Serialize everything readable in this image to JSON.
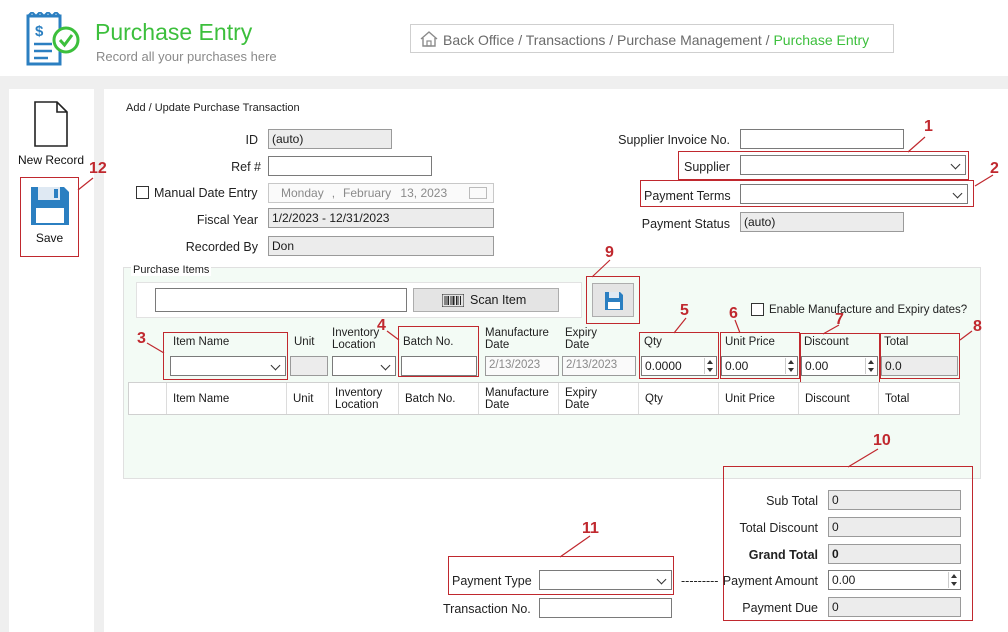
{
  "header": {
    "title": "Purchase Entry",
    "subtitle": "Record all your purchases here",
    "breadcrumb": {
      "part1": "Back Office / Transactions / Purchase Management / ",
      "active": "Purchase Entry"
    }
  },
  "toolbar": {
    "new_label": "New Record",
    "save_label": "Save"
  },
  "form": {
    "group_title": "Add / Update Purchase Transaction",
    "id_label": "ID",
    "id_value": "(auto)",
    "ref_label": "Ref #",
    "ref_value": "",
    "manual_date_label": "Manual Date Entry",
    "date_day": "Monday",
    "date_sep": ",",
    "date_month": "February",
    "date_rest": "13, 2023",
    "fiscal_label": "Fiscal Year",
    "fiscal_value": "1/2/2023 - 12/31/2023",
    "recorded_label": "Recorded By",
    "recorded_value": "Don",
    "supplier_invoice_label": "Supplier Invoice No.",
    "supplier_invoice_value": "",
    "supplier_label": "Supplier",
    "supplier_value": "",
    "payment_terms_label": "Payment Terms",
    "payment_terms_value": "",
    "payment_status_label": "Payment Status",
    "payment_status_value": "(auto)"
  },
  "items": {
    "group_title": "Purchase Items",
    "scan_input": "",
    "scan_label": "Scan Item",
    "enable_label": "Enable Manufacture and Expiry dates?",
    "col_item": "Item Name",
    "col_unit": "Unit",
    "col_loc1": "Inventory",
    "col_loc2": "Location",
    "col_batch": "Batch No.",
    "col_mfg1": "Manufacture",
    "col_mfg2": "Date",
    "col_exp1": "Expiry",
    "col_exp2": "Date",
    "col_qty": "Qty",
    "col_price": "Unit Price",
    "col_disc": "Discount",
    "col_total": "Total",
    "mfg_value": "2/13/2023",
    "exp_value": "2/13/2023",
    "qty_value": "0.0000",
    "price_value": "0.00",
    "disc_value": "0.00",
    "total_value": "0.0"
  },
  "totals": {
    "sub_label": "Sub Total",
    "sub_value": "0",
    "disc_label": "Total Discount",
    "disc_value": "0",
    "grand_label": "Grand Total",
    "grand_value": "0",
    "amount_label": "Payment Amount",
    "amount_value": "0.00",
    "due_label": "Payment Due",
    "due_value": "0",
    "payment_type_label": "Payment Type",
    "payment_type_value": "",
    "dashes": "---------",
    "transaction_label": "Transaction No.",
    "transaction_value": ""
  },
  "callouts": [
    "1",
    "2",
    "3",
    "4",
    "5",
    "6",
    "7",
    "8",
    "9",
    "10",
    "11",
    "12"
  ],
  "colors": {
    "accent_green": "#3cbf3c",
    "callout_red": "#c0282e",
    "logo_blue": "#2b7fc1"
  }
}
